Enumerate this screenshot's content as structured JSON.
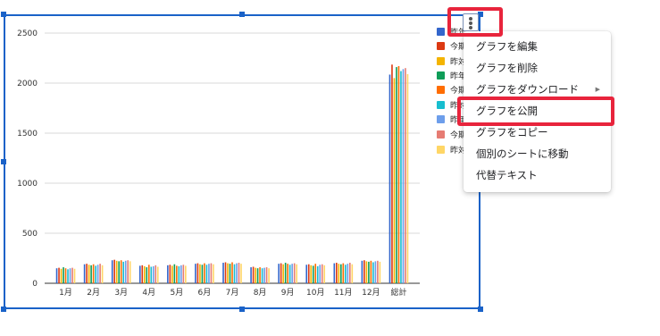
{
  "menu": {
    "items": [
      {
        "label": "グラフを編集"
      },
      {
        "label": "グラフを削除"
      },
      {
        "label": "グラフをダウンロード",
        "submenu": true,
        "arrow": "▶"
      },
      {
        "label": "グラフを公開"
      },
      {
        "label": "グラフをコピー"
      },
      {
        "label": "個別のシートに移動"
      },
      {
        "label": "代替テキスト"
      }
    ]
  },
  "kebab_icon": "more-vertical-icon",
  "highlight_color": "#e8243c",
  "selection_color": "#1a62c8",
  "chart_data": {
    "type": "bar",
    "categories": [
      "1月",
      "2月",
      "3月",
      "4月",
      "5月",
      "6月",
      "7月",
      "8月",
      "9月",
      "10月",
      "11月",
      "12月",
      "総計"
    ],
    "ylim": [
      0,
      2600
    ],
    "yticks": [
      0,
      500,
      1000,
      1500,
      2000,
      2500
    ],
    "grid": true,
    "legend_position": "right",
    "series": [
      {
        "name": "昨年",
        "color": "#3366cc",
        "values": [
          150,
          190,
          230,
          175,
          180,
          195,
          205,
          160,
          195,
          185,
          200,
          225,
          2085
        ]
      },
      {
        "name": "今期",
        "color": "#dc3912",
        "values": [
          155,
          195,
          235,
          180,
          185,
          200,
          210,
          165,
          200,
          190,
          205,
          230,
          2185
        ]
      },
      {
        "name": "昨対",
        "color": "#f4b400",
        "values": [
          145,
          185,
          225,
          170,
          175,
          190,
          200,
          155,
          190,
          180,
          195,
          220,
          2050
        ]
      },
      {
        "name": "昨年",
        "color": "#0f9d58",
        "values": [
          160,
          180,
          220,
          160,
          190,
          185,
          195,
          150,
          205,
          175,
          190,
          215,
          2160
        ]
      },
      {
        "name": "今期",
        "color": "#ff6d01",
        "values": [
          150,
          190,
          230,
          185,
          175,
          200,
          210,
          160,
          195,
          195,
          200,
          225,
          2170
        ]
      },
      {
        "name": "昨対",
        "color": "#17becf",
        "values": [
          140,
          175,
          215,
          165,
          170,
          185,
          190,
          150,
          185,
          170,
          185,
          210,
          2120
        ]
      },
      {
        "name": "昨年",
        "color": "#6d9eeb",
        "values": [
          150,
          185,
          225,
          170,
          180,
          195,
          200,
          155,
          195,
          185,
          195,
          220,
          2140
        ]
      },
      {
        "name": "今期",
        "color": "#e67c73",
        "values": [
          155,
          195,
          230,
          180,
          185,
          200,
          205,
          160,
          200,
          190,
          205,
          225,
          2150
        ]
      },
      {
        "name": "昨対",
        "color": "#ffd666",
        "values": [
          145,
          180,
          220,
          165,
          175,
          190,
          195,
          150,
          190,
          180,
          190,
          215,
          2090
        ]
      }
    ],
    "legend_labels": [
      "昨年",
      "今期",
      "昨対",
      "昨年",
      "今期",
      "昨対",
      "昨年",
      "今期",
      "昨対"
    ]
  }
}
